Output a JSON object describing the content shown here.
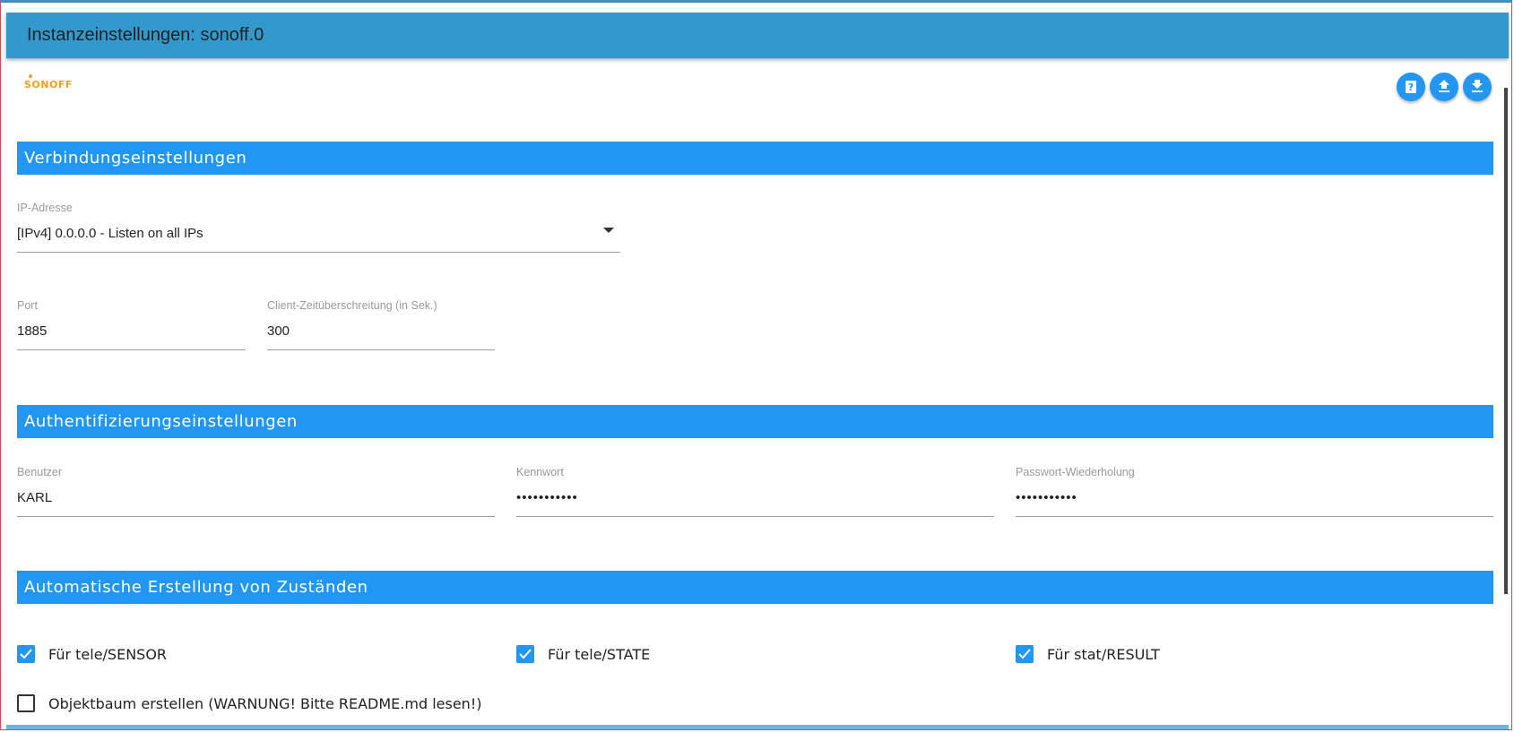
{
  "window": {
    "title": "Instanzeinstellungen: sonoff.0"
  },
  "logo": {
    "text": "SONOFF",
    "color": "#f0a020"
  },
  "toolbar": {
    "help_icon": "help-book-icon",
    "upload_icon": "upload-icon",
    "download_icon": "download-icon"
  },
  "sections": {
    "connection": {
      "title": "Verbindungseinstellungen",
      "ip_label": "IP-Adresse",
      "ip_value": "[IPv4] 0.0.0.0 - Listen on all IPs",
      "port_label": "Port",
      "port_value": "1885",
      "timeout_label": "Client-Zeitüberschreitung (in Sek.)",
      "timeout_value": "300"
    },
    "auth": {
      "title": "Authentifizierungseinstellungen",
      "user_label": "Benutzer",
      "user_value": "KARL",
      "password_label": "Kennwort",
      "password_value": "•••••••••••",
      "password_repeat_label": "Passwort-Wiederholung",
      "password_repeat_value": "•••••••••••"
    },
    "states": {
      "title": "Automatische Erstellung von Zuständen",
      "checkboxes": [
        {
          "label": "Für tele/SENSOR",
          "checked": true
        },
        {
          "label": "Für tele/STATE",
          "checked": true
        },
        {
          "label": "Für stat/RESULT",
          "checked": true
        },
        {
          "label": "Objektbaum erstellen (WARNUNG! Bitte README.md lesen!)",
          "checked": false
        }
      ]
    }
  },
  "colors": {
    "title_bar": "#3399cc",
    "section_header": "#2196f3",
    "accent": "#2196f3"
  }
}
